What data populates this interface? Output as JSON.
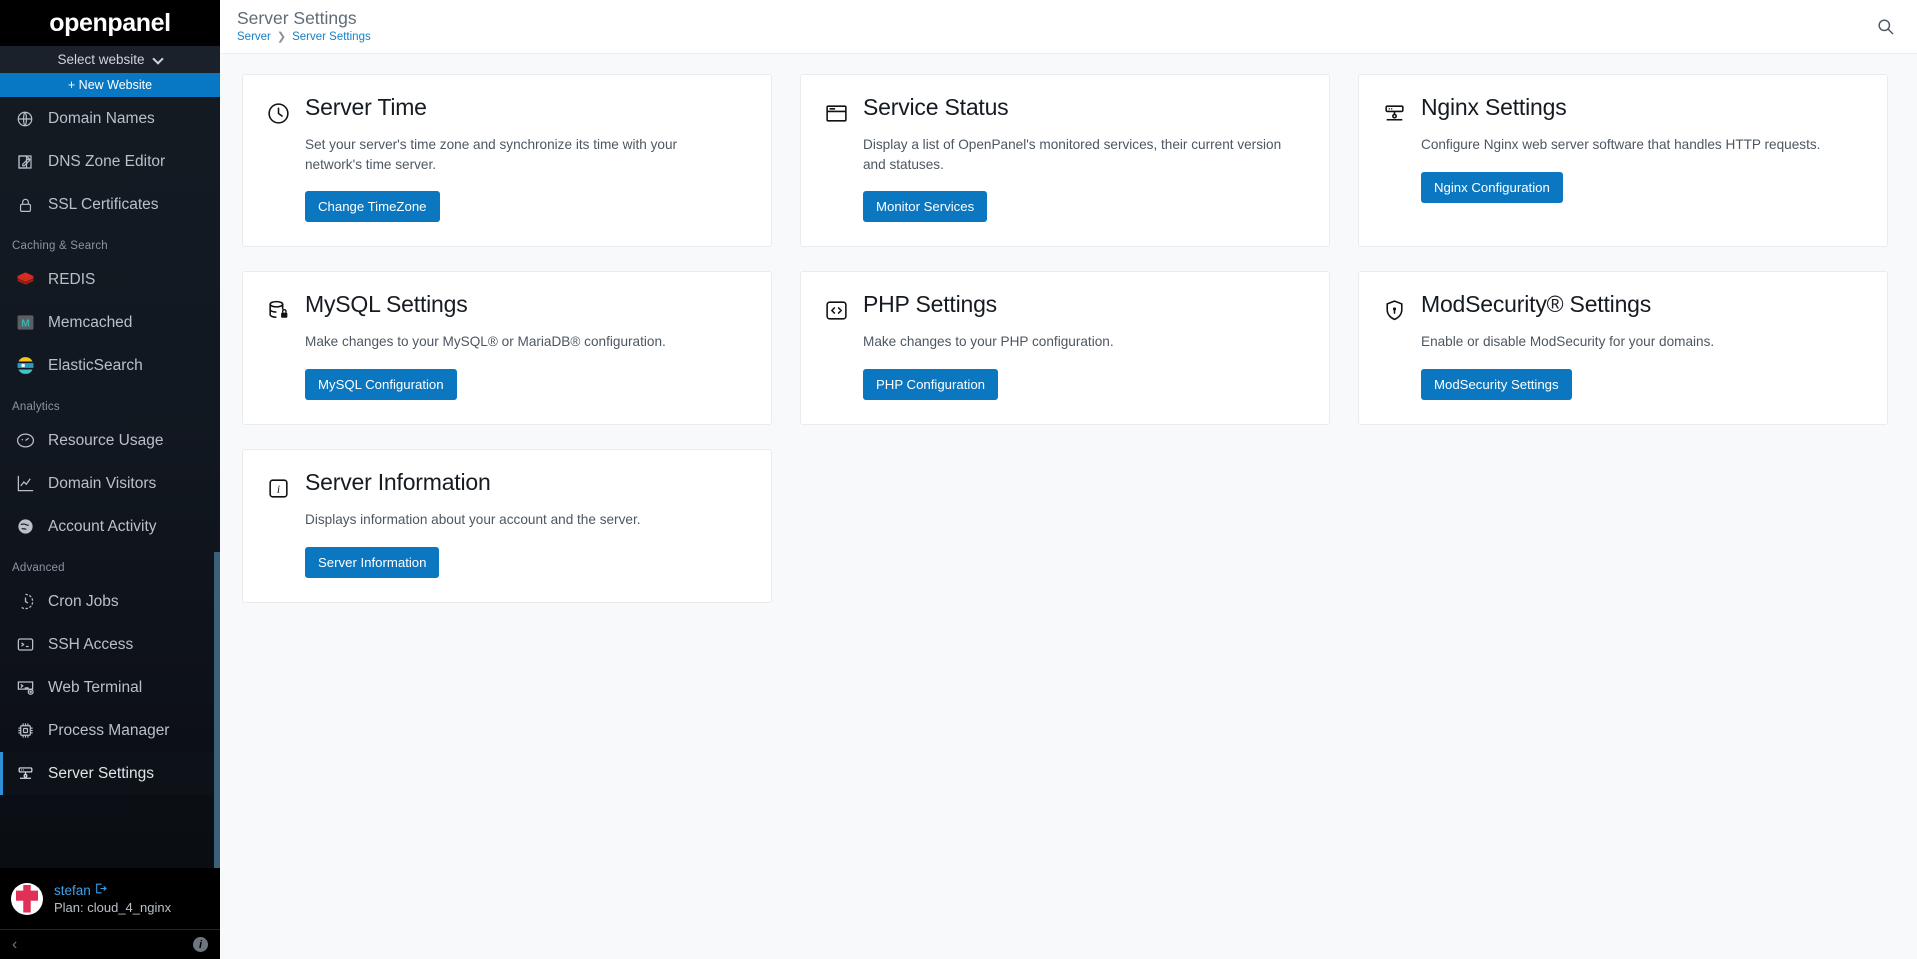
{
  "brand": {
    "name": "openpanel"
  },
  "sidebar": {
    "site_selector": {
      "label": "Select website",
      "icon": "chevron-down-icon"
    },
    "new_website": {
      "label": "+ New Website"
    },
    "groups": [
      {
        "section": null,
        "items": [
          {
            "label": "Domain Names",
            "icon": "globe-icon",
            "active": false
          },
          {
            "label": "DNS Zone Editor",
            "icon": "edit-square-icon",
            "active": false
          },
          {
            "label": "SSL Certificates",
            "icon": "lock-icon",
            "active": false
          }
        ]
      },
      {
        "section": "Caching & Search",
        "items": [
          {
            "label": "REDIS",
            "icon": "redis-icon",
            "active": false
          },
          {
            "label": "Memcached",
            "icon": "memcached-icon",
            "active": false
          },
          {
            "label": "ElasticSearch",
            "icon": "elasticsearch-icon",
            "active": false
          }
        ]
      },
      {
        "section": "Analytics",
        "items": [
          {
            "label": "Resource Usage",
            "icon": "gauge-icon",
            "active": false
          },
          {
            "label": "Domain Visitors",
            "icon": "line-chart-icon",
            "active": false
          },
          {
            "label": "Account Activity",
            "icon": "globe-activity-icon",
            "active": false
          }
        ]
      },
      {
        "section": "Advanced",
        "items": [
          {
            "label": "Cron Jobs",
            "icon": "clock-dashed-icon",
            "active": false
          },
          {
            "label": "SSH Access",
            "icon": "terminal-icon",
            "active": false
          },
          {
            "label": "Web Terminal",
            "icon": "terminal-x-icon",
            "active": false
          },
          {
            "label": "Process Manager",
            "icon": "cpu-icon",
            "active": false
          },
          {
            "label": "Server Settings",
            "icon": "server-icon",
            "active": true
          }
        ]
      }
    ],
    "user": {
      "name": "stefan",
      "logout_icon": "logout-icon",
      "plan": "Plan: cloud_4_nginx",
      "avatar": "avatar"
    },
    "footer": {
      "collapse_icon": "chevron-left-icon",
      "info_icon": "info-icon"
    }
  },
  "topbar": {
    "title": "Server Settings",
    "breadcrumb": [
      "Server",
      "Server Settings"
    ],
    "breadcrumb_separator": "❯",
    "search_icon": "search-icon"
  },
  "cards": [
    {
      "icon": "clock-icon",
      "title": "Server Time",
      "description": "Set your server's time zone and synchronize its time with your network's time server.",
      "button": "Change TimeZone"
    },
    {
      "icon": "browser-window-icon",
      "title": "Service Status",
      "description": "Display a list of OpenPanel's monitored services, their current version and statuses.",
      "button": "Monitor Services"
    },
    {
      "icon": "server-icon",
      "title": "Nginx Settings",
      "description": "Configure Nginx web server software that handles HTTP requests.",
      "button": "Nginx Configuration"
    },
    {
      "icon": "database-lock-icon",
      "title": "MySQL Settings",
      "description": "Make changes to your MySQL® or MariaDB® configuration.",
      "button": "MySQL Configuration"
    },
    {
      "icon": "code-brackets-icon",
      "title": "PHP Settings",
      "description": "Make changes to your PHP configuration.",
      "button": "PHP Configuration"
    },
    {
      "icon": "shield-lock-icon",
      "title": "ModSecurity® Settings",
      "description": "Enable or disable ModSecurity for your domains.",
      "button": "ModSecurity Settings"
    },
    {
      "icon": "info-square-icon",
      "title": "Server Information",
      "description": "Displays information about your account and the server.",
      "button": "Server Information"
    }
  ],
  "colors": {
    "accent_blue": "#0a77c0",
    "sidebar_bg": "#141a22",
    "sidebar_black": "#000000",
    "link_blue": "#1580c8",
    "active_border": "#2e90d6",
    "page_bg": "#f8f9fb",
    "card_bg": "#ffffff"
  }
}
